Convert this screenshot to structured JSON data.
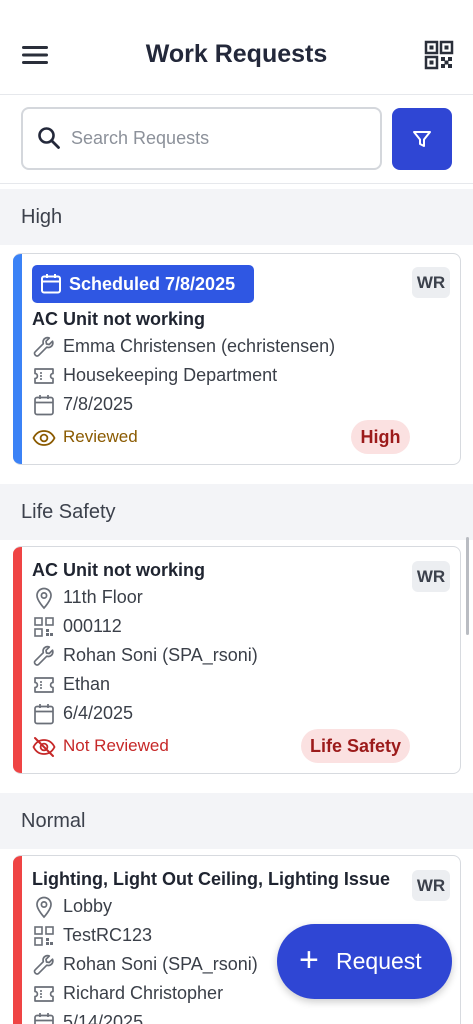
{
  "header": {
    "title": "Work Requests",
    "menu_icon": "hamburger-menu-icon",
    "qr_icon": "qr-code-icon"
  },
  "search": {
    "placeholder": "Search Requests",
    "value": ""
  },
  "groups": [
    {
      "name": "High",
      "cards": [
        {
          "scheduled_label": "Scheduled 7/8/2025",
          "type_tag": "WR",
          "title": "AC Unit not working",
          "assignee": "Emma Christensen (echristensen)",
          "requester": "Housekeeping Department",
          "date": "7/8/2025",
          "status": "Reviewed",
          "priority": "High",
          "stripe_color": "#3b82f6"
        }
      ]
    },
    {
      "name": "Life Safety",
      "cards": [
        {
          "type_tag": "WR",
          "title": "AC Unit not working",
          "location": "11th Floor",
          "asset_code": "000112",
          "assignee": "Rohan Soni (SPA_rsoni)",
          "requester": "Ethan",
          "date": "6/4/2025",
          "status": "Not Reviewed",
          "priority": "Life Safety",
          "stripe_color": "#ef4444"
        }
      ]
    },
    {
      "name": "Normal",
      "cards": [
        {
          "type_tag": "WR",
          "title": "Lighting, Light Out Ceiling, Lighting Issue",
          "location": "Lobby",
          "asset_code": "TestRC123",
          "assignee": "Rohan Soni (SPA_rsoni)",
          "requester": "Richard Christopher",
          "date": "5/14/2025",
          "stripe_color": "#ef4444"
        }
      ]
    }
  ],
  "fab": {
    "label": "Request"
  },
  "colors": {
    "primary": "#2f46d4",
    "badge": "#2f57e3",
    "high_stripe": "#3b82f6",
    "red_stripe": "#ef4444",
    "pill_bg": "#fbe1e1",
    "pill_text": "#9c1b1b"
  }
}
